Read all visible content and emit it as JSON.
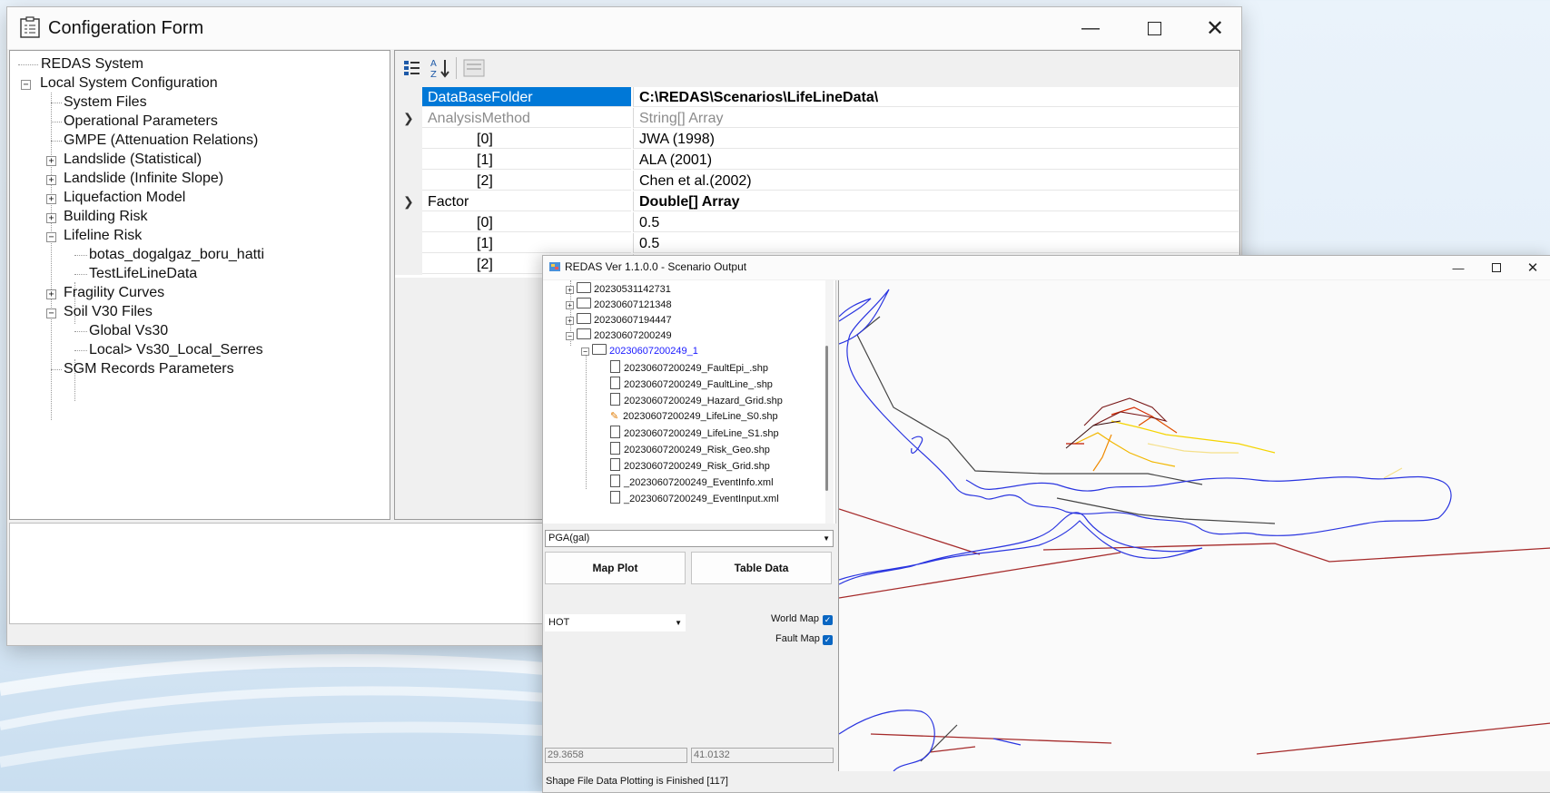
{
  "config_window": {
    "title": "Configeration Form",
    "tree": [
      "REDAS System",
      "Local System Configuration",
      "System Files",
      "Operational Parameters",
      "GMPE (Attenuation Relations)",
      "Landslide (Statistical)",
      "Landslide (Infinite Slope)",
      "Liquefaction Model",
      "Building Risk",
      "Lifeline Risk",
      "botas_dogalgaz_boru_hatti",
      "TestLifeLineData",
      "Fragility Curves",
      "Soil V30 Files",
      "Global Vs30",
      "Local> Vs30_Local_Serres",
      "SGM Records Parameters"
    ],
    "properties": {
      "database_folder_name": "DataBaseFolder",
      "database_folder_value": "C:\\REDAS\\Scenarios\\LifeLineData\\",
      "analysis_method_name": "AnalysisMethod",
      "analysis_method_value": "String[] Array",
      "analysis_items": [
        {
          "index": "[0]",
          "value": "JWA (1998)"
        },
        {
          "index": "[1]",
          "value": "ALA (2001)"
        },
        {
          "index": "[2]",
          "value": "Chen et al.(2002)"
        }
      ],
      "factor_name": "Factor",
      "factor_value": "Double[] Array",
      "factor_items": [
        {
          "index": "[0]",
          "value": "0.5"
        },
        {
          "index": "[1]",
          "value": "0.5"
        },
        {
          "index": "[2]",
          "value": ""
        }
      ]
    }
  },
  "scenario_window": {
    "title": "REDAS Ver 1.1.0.0 - Scenario Output",
    "tree": {
      "folders": [
        "20230531142731",
        "20230607121348",
        "20230607194447",
        "20230607200249"
      ],
      "selected": "20230607200249_1",
      "files": [
        "20230607200249_FaultEpi_.shp",
        "20230607200249_FaultLine_.shp",
        "20230607200249_Hazard_Grid.shp",
        "20230607200249_LifeLine_S0.shp",
        "20230607200249_LifeLine_S1.shp",
        "20230607200249_Risk_Geo.shp",
        "20230607200249_Risk_Grid.shp",
        "_20230607200249_EventInfo.xml",
        "_20230607200249_EventInput.xml"
      ]
    },
    "param_select": "PGA(gal)",
    "map_plot_label": "Map Plot",
    "table_data_label": "Table Data",
    "colormap_select": "HOT",
    "world_map_label": "World Map",
    "fault_map_label": "Fault Map",
    "world_map_checked": true,
    "fault_map_checked": true,
    "coord_x": "29.3658",
    "coord_y": "41.0132",
    "status": "Shape File Data Plotting is Finished [117]"
  },
  "colors": {
    "selection": "#0078d7",
    "coastline": "#2a35e0",
    "fault": "#a52a2a",
    "checkbox": "#0a66c2"
  }
}
